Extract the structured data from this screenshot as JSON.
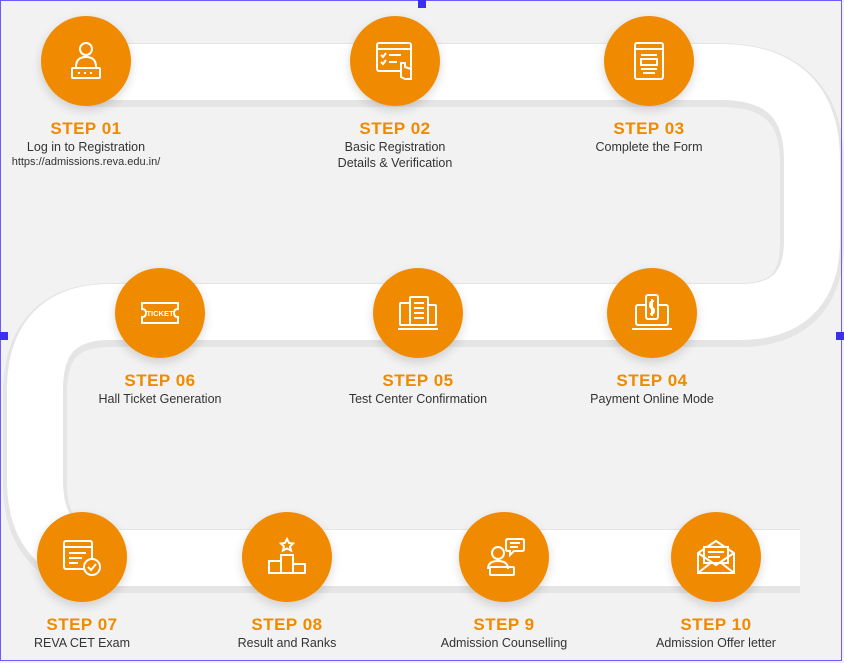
{
  "steps": [
    {
      "title": "STEP 01",
      "desc": "Log in to Registration",
      "url": "https://admissions.reva.edu.in/",
      "icon": "user-login-icon"
    },
    {
      "title": "STEP 02",
      "desc": "Basic Registration",
      "desc2": "Details & Verification",
      "icon": "registration-form-icon"
    },
    {
      "title": "STEP 03",
      "desc": "Complete the Form",
      "icon": "form-document-icon"
    },
    {
      "title": "STEP 04",
      "desc": "Payment Online Mode",
      "icon": "online-payment-icon"
    },
    {
      "title": "STEP 05",
      "desc": "Test Center Confirmation",
      "icon": "test-center-icon"
    },
    {
      "title": "STEP 06",
      "desc": "Hall Ticket Generation",
      "icon": "ticket-icon",
      "ticket_text": "TICKET"
    },
    {
      "title": "STEP 07",
      "desc": "REVA CET Exam",
      "icon": "exam-check-icon"
    },
    {
      "title": "STEP 08",
      "desc": "Result and Ranks",
      "icon": "podium-icon"
    },
    {
      "title": "STEP 9",
      "desc": "Admission Counselling",
      "icon": "counselling-icon"
    },
    {
      "title": "STEP 10",
      "desc": "Admission Offer letter",
      "icon": "offer-letter-icon"
    }
  ],
  "colors": {
    "accent": "#f08a00",
    "road": "#ffffff",
    "background": "#f2f2f2",
    "text": "#333333"
  }
}
